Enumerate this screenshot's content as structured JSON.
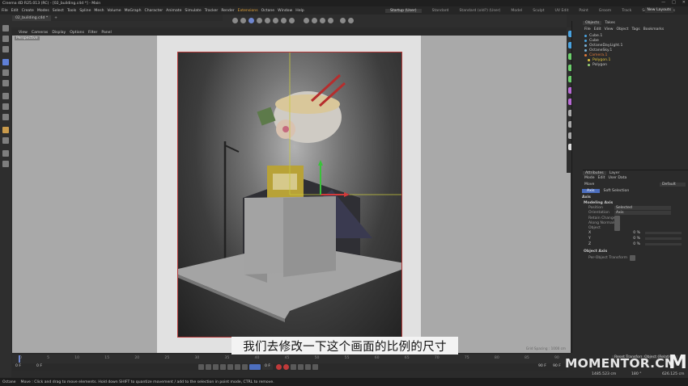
{
  "window": {
    "title": "Cinema 4D R25.013 (RC) - [02_building.c4d *] - Main",
    "controls": [
      "—",
      "□",
      "✕"
    ]
  },
  "menubar": {
    "items": [
      "File",
      "Edit",
      "Create",
      "Modes",
      "Select",
      "Tools",
      "Spline",
      "Mesh",
      "Volume",
      "MoGraph",
      "Character",
      "Animate",
      "Simulate",
      "Tracker",
      "Render",
      "Extensions",
      "Octane",
      "Window",
      "Help"
    ],
    "highlight": "Extensions",
    "layouts": [
      "Startup (User)",
      "Standard",
      "Standard (old?) (User)",
      "Model",
      "Sculpt",
      "UV Edit",
      "Paint",
      "Groom",
      "Track",
      "Script",
      "Nodes"
    ],
    "active_layout": "Startup (User)",
    "new_layouts": "New Layouts"
  },
  "tabs": {
    "doc": "02_building.c4d *",
    "add": "+"
  },
  "viewport": {
    "menu": [
      "View",
      "Cameras",
      "Display",
      "Options",
      "Filter",
      "Panel"
    ],
    "camera_label": "Perspective",
    "grid_info": "Grid Spacing : 1000 cm"
  },
  "objects_panel": {
    "tabs": [
      "Objects",
      "Takes"
    ],
    "menu": [
      "File",
      "Edit",
      "View",
      "Object",
      "Tags",
      "Bookmarks"
    ],
    "items": [
      {
        "name": "Cube.1",
        "color": "#4aa3e0"
      },
      {
        "name": "Cube",
        "color": "#4aa3e0"
      },
      {
        "name": "OctaneDayLight.1",
        "color": "#7ab2d9"
      },
      {
        "name": "OctaneSky.1",
        "color": "#7ab2d9"
      },
      {
        "name": "Camera.1",
        "color": "#e07a3a"
      },
      {
        "name": "Polygon.1",
        "color": "#e0c23a"
      },
      {
        "name": "Polygon",
        "color": "#9ad27a"
      }
    ]
  },
  "attributes_panel": {
    "tabs": [
      "Attributes",
      "Layer"
    ],
    "menu": [
      "Mode",
      "Edit",
      "User Data"
    ],
    "mode": "Move",
    "preset": "Default",
    "subtabs": [
      "Axis",
      "Soft Selection"
    ],
    "section": "Axis",
    "modeling_axis": "Modeling Axis",
    "fields": [
      {
        "label": "Position",
        "value": "Selected"
      },
      {
        "label": "Orientation",
        "value": "Axis"
      },
      {
        "label": "Retain Changes",
        "value": ""
      },
      {
        "label": "Along Normals",
        "value": ""
      },
      {
        "label": "Object",
        "value": ""
      }
    ],
    "xyz": [
      {
        "axis": "X",
        "value": "0 %"
      },
      {
        "axis": "Y",
        "value": "0 %"
      },
      {
        "axis": "Z",
        "value": "0 %"
      }
    ],
    "object_axis": "Object Axis",
    "per_object": "Per-Object Transform"
  },
  "timeline": {
    "ticks": [
      "0",
      "5",
      "10",
      "15",
      "20",
      "25",
      "30",
      "35",
      "40",
      "45",
      "50",
      "55",
      "60",
      "65",
      "70",
      "75",
      "80",
      "85",
      "90"
    ],
    "start_frame": "0 F",
    "current_frame": "0 F",
    "end_frame": "90 F",
    "end_frame2": "90 F",
    "frame_field": "0 F"
  },
  "coords": {
    "reset": "Reset Transform",
    "mode": "Object (Relative)",
    "size": "1485.523 cm",
    "rot": "180 °",
    "third": "626.125 cm"
  },
  "status": {
    "text": "Move : Click and drag to move elements. Hold down SHIFT to quantize movement / add to the selection in point mode, CTRL to remove.",
    "prefix": "Octane"
  },
  "overlay": {
    "subtitle": "我们去修改一下这个画面的比例的尺寸",
    "watermark": "MOMENTOR.CN",
    "watermark_logo": "M"
  }
}
